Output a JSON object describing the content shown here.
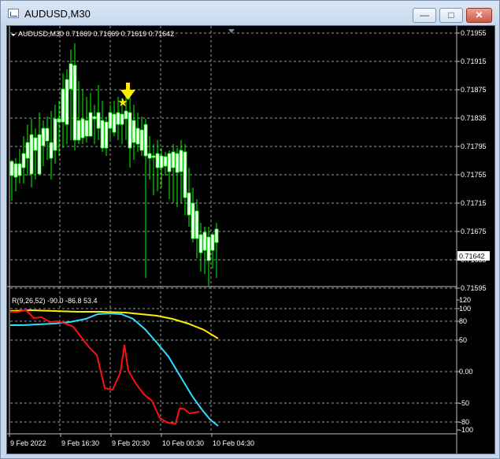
{
  "window": {
    "title": "AUDUSD,M30",
    "buttons": {
      "minimize": "—",
      "maximize": "□",
      "close": "✕"
    }
  },
  "chart": {
    "info": "AUDUSD,M30  0.71669 0.71669 0.71619 0.71642",
    "current_price": "0.71642",
    "price_ticks": [
      "0.71955",
      "0.71915",
      "0.71875",
      "0.71835",
      "0.71795",
      "0.71755",
      "0.71715",
      "0.71675",
      "0.71635",
      "0.71595"
    ],
    "time_ticks": [
      "9 Feb 2022",
      "9 Feb 16:30",
      "9 Feb 20:30",
      "10 Feb 00:30",
      "10 Feb 04:30"
    ],
    "colors": {
      "bull": "#ffffff",
      "bear": "#ffffff",
      "wick": "#00ff00",
      "grid": "#c0c0c0",
      "arrow": "#ffee00"
    }
  },
  "indicator": {
    "label": "R(9,26,52) -90.0 -86.8 53.4",
    "ticks": [
      "120",
      "100",
      "80",
      "50",
      "0.00",
      "-50",
      "-80",
      "-100"
    ],
    "colors": {
      "red": "#ff1010",
      "cyan": "#33ddff",
      "yellow": "#ffee00"
    }
  }
}
